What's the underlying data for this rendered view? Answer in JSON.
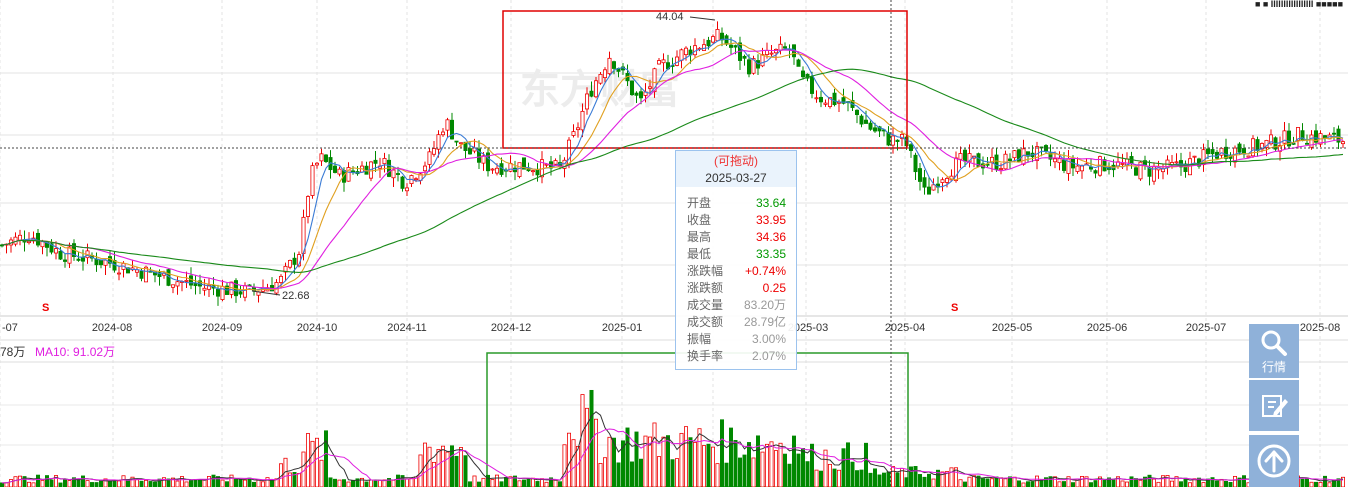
{
  "chart_data": {
    "type": "candlestick",
    "x_axis_labels": [
      "-07",
      "2024-08",
      "2024-09",
      "2024-10",
      "2024-11",
      "2024-12",
      "2025-01",
      "2025-03",
      "2025-04",
      "2025-05",
      "2025-06",
      "2025-07",
      "2025-08"
    ],
    "y_range_visible": [
      19.5,
      45.5
    ],
    "annotations": {
      "max_price": "44.04",
      "min_price": "22.68"
    },
    "ma_colors": {
      "ma5": "#3a7bd5",
      "ma10": "#e0a020",
      "ma20": "#e020e0",
      "ma60": "#1a8a1a"
    },
    "volume_indicators": {
      "ma5_partial": "78万",
      "ma10": "MA10: 91.02万"
    },
    "highlight_boxes": {
      "price_box_color": "#e00000",
      "volume_box_color": "#2a9a2a"
    },
    "watermark": "东方财富",
    "top_right_text": "■ ■ IIIIIIIIIIIIIIIII ■■■■■"
  },
  "tooltip": {
    "drag_label": "(可拖动)",
    "date": "2025-03-27",
    "rows": [
      {
        "key": "开盘",
        "value": "33.64",
        "color": "green"
      },
      {
        "key": "收盘",
        "value": "33.95",
        "color": "red"
      },
      {
        "key": "最高",
        "value": "34.36",
        "color": "red"
      },
      {
        "key": "最低",
        "value": "33.35",
        "color": "green"
      },
      {
        "key": "涨跌幅",
        "value": "+0.74%",
        "color": "red"
      },
      {
        "key": "涨跌额",
        "value": "0.25",
        "color": "red"
      },
      {
        "key": "成交量",
        "value": "83.20万",
        "color": "gray"
      },
      {
        "key": "成交额",
        "value": "28.79亿",
        "color": "gray"
      },
      {
        "key": "振幅",
        "value": "3.00%",
        "color": "gray"
      },
      {
        "key": "换手率",
        "value": "2.07%",
        "color": "gray"
      }
    ]
  },
  "sidebar": {
    "quote_label": "行情",
    "colors": {
      "button_bg": "#8fb1d9"
    }
  }
}
